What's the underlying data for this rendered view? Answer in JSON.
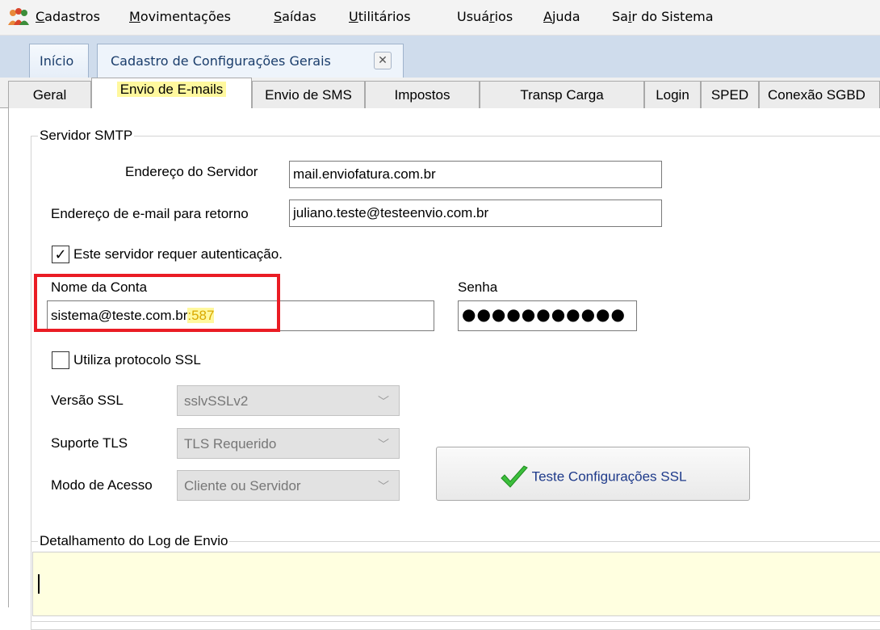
{
  "menu": {
    "items": [
      {
        "label": "Cadastros",
        "underline": "C",
        "rest": "adastros"
      },
      {
        "label": "Movimentações",
        "underline": "M",
        "rest": "ovimentações"
      },
      {
        "label": "Saídas",
        "underline": "S",
        "rest": "aídas"
      },
      {
        "label": "Utilitários",
        "underline": "U",
        "rest": "tilitários"
      },
      {
        "label": "Usuários",
        "pre": "Usuá",
        "underline": "r",
        "rest": "ios"
      },
      {
        "label": "Ajuda",
        "underline": "A",
        "rest": "juda"
      },
      {
        "label": "Sair do Sistema",
        "pre": "Sa",
        "underline": "i",
        "rest": "r do Sistema"
      }
    ]
  },
  "doc_tabs": [
    {
      "label": "Início"
    },
    {
      "label": "Cadastro de Configurações Gerais",
      "close": "✕"
    }
  ],
  "page_tabs": [
    {
      "label": "Geral"
    },
    {
      "label": "Envio de E-mails"
    },
    {
      "label": "Envio de SMS"
    },
    {
      "label": "Impostos"
    },
    {
      "label": "Transp Carga"
    },
    {
      "label": "Login"
    },
    {
      "label": "SPED"
    },
    {
      "label": "Conexão SGBD"
    }
  ],
  "smtp": {
    "legend": "Servidor SMTP",
    "server_label": "Endereço do Servidor",
    "server_value": "mail.enviofatura.com.br",
    "return_label": "Endereço de e-mail para retorno",
    "return_value": "juliano.teste@testeenvio.com.br",
    "auth_label": "Este servidor requer autenticação.",
    "auth_checked": "✓",
    "account_label": "Nome da Conta",
    "account_value": "sistema@teste.com.br",
    "account_port": ":587",
    "password_label": "Senha",
    "password_value": "●●●●●●●●●●●"
  },
  "ssl": {
    "ssl_label": "Utiliza protocolo SSL",
    "version_label": "Versão SSL",
    "version_value": "sslvSSLv2",
    "tls_label": "Suporte TLS",
    "tls_value": "TLS Requerido",
    "access_label": "Modo de Acesso",
    "access_value": "Cliente ou Servidor",
    "test_button": "Teste Configurações SSL"
  },
  "log": {
    "legend": "Detalhamento do Log de Envio"
  },
  "colors": {
    "highlight_yellow": "#fff89e",
    "annotation_red": "#ea1c24",
    "log_background": "#ffffe0"
  }
}
